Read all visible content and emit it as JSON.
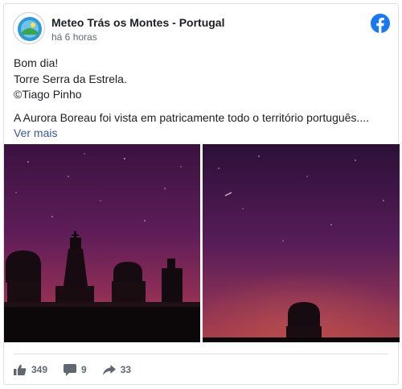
{
  "post": {
    "page_name": "Meteo Trás os Montes - Portugal",
    "timestamp": "há 6 horas",
    "lines": [
      "Bom dia!",
      "Torre Serra da Estrela.",
      "©Tiago Pinho"
    ],
    "excerpt": "A Aurora Boreau foi vista em patricamente todo o território português....",
    "see_more": "Ver mais"
  },
  "photos": [
    {
      "icon": "night-sky-towers-photo"
    },
    {
      "icon": "aurora-sky-dome-photo"
    }
  ],
  "stats": {
    "likes": "349",
    "comments": "9",
    "shares": "33"
  },
  "colors": {
    "facebook_blue": "#1877f2",
    "link": "#385898",
    "text": "#1c1e21",
    "muted": "#606770"
  }
}
